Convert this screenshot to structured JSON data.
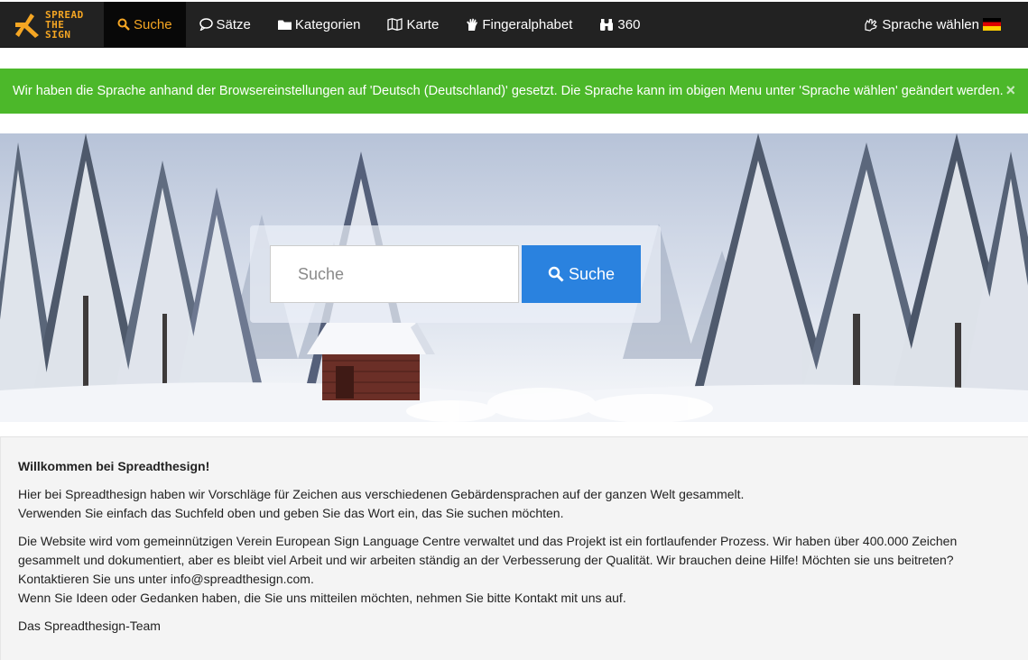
{
  "brand": {
    "line1": "SPREAD",
    "line2": "THE",
    "line3": "SIGN",
    "color": "#f5a623"
  },
  "nav": {
    "items": [
      {
        "label": "Suche",
        "icon": "search-icon"
      },
      {
        "label": "Sätze",
        "icon": "speech-bubble-icon"
      },
      {
        "label": "Kategorien",
        "icon": "folder-icon"
      },
      {
        "label": "Karte",
        "icon": "map-icon"
      },
      {
        "label": "Fingeralphabet",
        "icon": "hand-icon"
      },
      {
        "label": "360",
        "icon": "binoculars-icon"
      }
    ],
    "language_label": "Sprache wählen",
    "language_icon": "sign-language-icon",
    "flag": "germany-flag"
  },
  "alert": {
    "text": "Wir haben die Sprache anhand der Browsereinstellungen auf 'Deutsch (Deutschland)' gesetzt. Die Sprache kann im obigen Menu unter 'Sprache wählen' geändert werden.",
    "close": "×",
    "color": "#4cb82a"
  },
  "search": {
    "placeholder": "Suche",
    "value": "",
    "button_label": "Suche",
    "button_color": "#2a82df"
  },
  "welcome": {
    "title": "Willkommen bei Spreadthesign!",
    "p1_line1": "Hier bei Spreadthesign haben wir Vorschläge für Zeichen aus verschiedenen Gebärdensprachen auf der ganzen Welt gesammelt.",
    "p1_line2": "Verwenden Sie einfach das Suchfeld oben und geben Sie das Wort ein, das Sie suchen möchten.",
    "p2_line1": "Die Website wird vom gemeinnützigen Verein European Sign Language Centre verwaltet und das Projekt ist ein fortlaufender Prozess. Wir haben über 400.000 Zeichen gesammelt und dokumentiert, aber es bleibt viel Arbeit und wir arbeiten ständig an der Verbesserung der Qualität. Wir brauchen deine Hilfe! Möchten sie uns beitreten? Kontaktieren Sie uns unter info@spreadthesign.com.",
    "p2_line2": "Wenn Sie Ideen oder Gedanken haben, die Sie uns mitteilen möchten, nehmen Sie bitte Kontakt mit uns auf.",
    "signature": "Das Spreadthesign-Team"
  }
}
